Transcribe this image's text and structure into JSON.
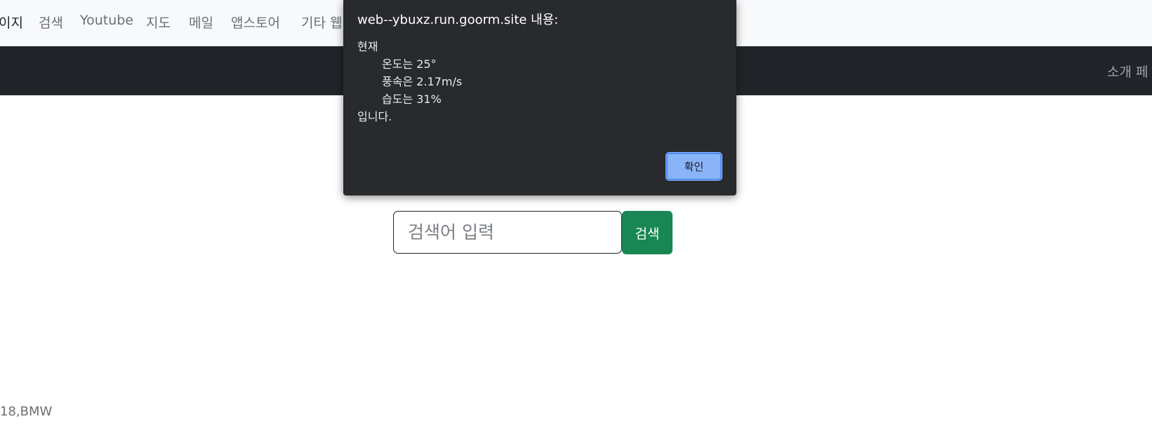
{
  "topnav": {
    "items": [
      "이지",
      "검색",
      "Youtube",
      "지도",
      "메일",
      "앱스토어",
      "기타 웹"
    ]
  },
  "darkbar": {
    "right_link": "소개 페"
  },
  "search": {
    "placeholder": "검색어 입력",
    "button_label": "검색"
  },
  "footer": {
    "text": "18,BMW"
  },
  "alert": {
    "title": "web--ybuxz.run.goorm.site 내용:",
    "lines": [
      "현재",
      "온도는 25°",
      "풍속은 2.17m/s",
      "습도는 31%",
      "입니다."
    ],
    "ok_label": "확인"
  },
  "colors": {
    "topnav_bg": "#f8f9fa",
    "darkbar_bg": "#212529",
    "search_button": "#198754",
    "alert_bg": "#292a2d",
    "alert_button": "#8ab4f8",
    "logo_blue": "#4a8ae6"
  }
}
